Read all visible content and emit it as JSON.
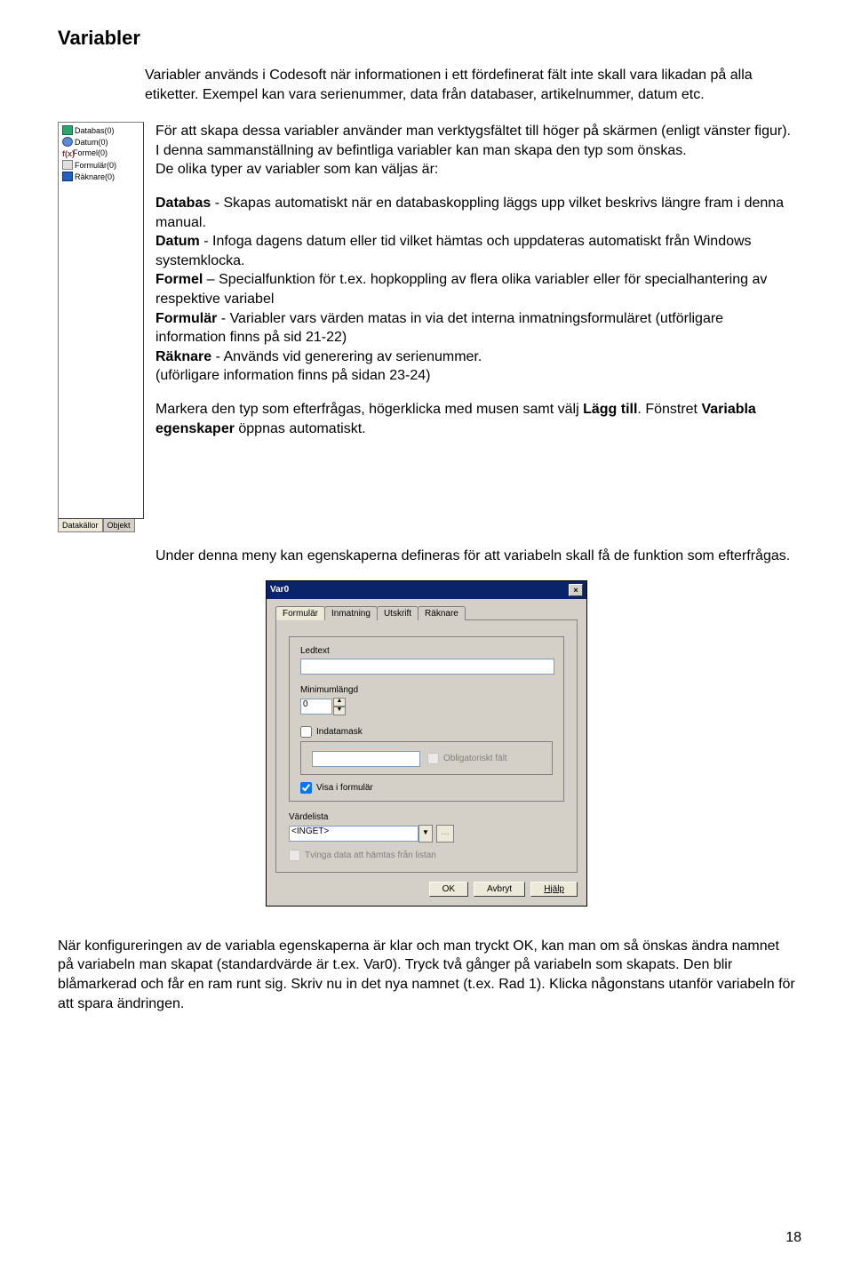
{
  "heading": "Variabler",
  "intro": "Variabler används i Codesoft när informationen i ett fördefinerat fält inte skall vara likadan på alla etiketter. Exempel kan vara serienummer, data från databaser, artikelnummer, datum etc.",
  "sidebar": {
    "items": [
      {
        "label": "Databas(0)"
      },
      {
        "label": "Datum(0)"
      },
      {
        "label": "Formel(0)"
      },
      {
        "label": "Formulär(0)"
      },
      {
        "label": "Räknare(0)"
      }
    ],
    "tabs": {
      "a": "Datakällor",
      "b": "Objekt"
    }
  },
  "para2": "För att skapa dessa variabler använder man verktygsfältet till höger på skärmen (enligt vänster figur). I denna sammanställning av befintliga variabler kan man skapa den typ som önskas.",
  "para2b": "De olika typer av variabler som kan väljas är:",
  "defs": {
    "db_label": "Databas",
    "db_text": " - Skapas automatiskt när en databaskoppling läggs upp vilket beskrivs längre fram i denna manual.",
    "date_label": "Datum",
    "date_text": " - Infoga dagens datum eller tid vilket hämtas och uppdateras automatiskt från Windows systemklocka.",
    "formel_label": "Formel",
    "formel_text": " – Specialfunktion för t.ex. hopkoppling av flera olika variabler eller för specialhantering av respektive variabel",
    "formular_label": "Formulär",
    "formular_text": " - Variabler vars värden matas in via det interna inmatningsformuläret (utförligare information finns på sid 21-22)",
    "counter_label": "Räknare",
    "counter_text": " - Används vid generering av serienummer.",
    "counter_extra": "(uförligare information finns på sidan 23-24)"
  },
  "mark_text_a": "Markera den typ som efterfrågas, högerklicka med musen samt välj ",
  "mark_text_b": "Lägg till",
  "mark_text_c": ". Fönstret ",
  "mark_text_d": "Variabla egenskaper",
  "mark_text_e": " öppnas automatiskt.",
  "under_menu": "Under denna meny kan egenskaperna defineras för att variabeln skall få de funktion som efterfrågas.",
  "dialog": {
    "title": "Var0",
    "tabs": {
      "a": "Formulär",
      "b": "Inmatning",
      "c": "Utskrift",
      "d": "Räknare"
    },
    "ledtext_label": "Ledtext",
    "minlen_label": "Minimumlängd",
    "minlen_value": "0",
    "indatamask": "Indatamask",
    "oblig": "Obligatoriskt fält",
    "visa": "Visa i formulär",
    "vardelista_label": "Värdelista",
    "vardelista_value": "<INGET>",
    "tvinga": "Tvinga data att hämtas från listan",
    "ok": "OK",
    "cancel": "Avbryt",
    "help": "Hjälp"
  },
  "footer": "När konfigureringen av de variabla egenskaperna är klar och man tryckt OK, kan man om så önskas ändra namnet på variabeln man skapat (standardvärde är t.ex. Var0). Tryck två gånger på variabeln som skapats. Den blir blåmarkerad och får en ram runt sig. Skriv nu in det nya namnet (t.ex. Rad 1). Klicka någonstans utanför variabeln för att spara ändringen.",
  "page_number": "18"
}
